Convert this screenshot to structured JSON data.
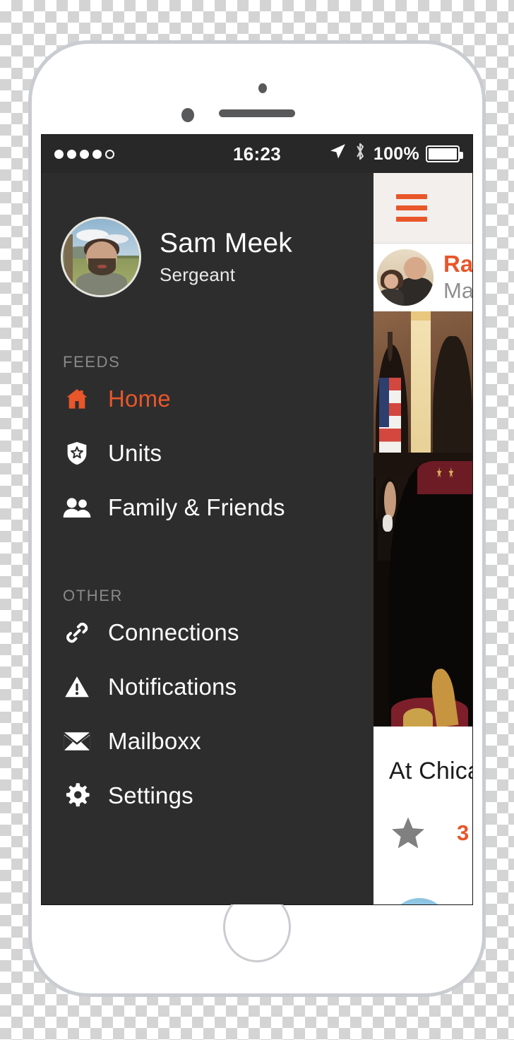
{
  "status_bar": {
    "signal_dots_filled": 4,
    "signal_dots_total": 5,
    "time": "16:23",
    "battery_percent": "100%",
    "location_icon": "location-arrow-icon",
    "bluetooth_icon": "bluetooth-icon",
    "battery_icon": "battery-full-icon"
  },
  "drawer": {
    "profile": {
      "name": "Sam Meek",
      "rank": "Sergeant",
      "avatar_alt": "sam-meek-avatar"
    },
    "sections": [
      {
        "title": "FEEDS",
        "items": [
          {
            "label": "Home",
            "icon": "home-icon",
            "active": true
          },
          {
            "label": "Units",
            "icon": "shield-star-icon",
            "active": false
          },
          {
            "label": "Family & Friends",
            "icon": "people-icon",
            "active": false
          }
        ]
      },
      {
        "title": "OTHER",
        "items": [
          {
            "label": "Connections",
            "icon": "link-icon",
            "active": false
          },
          {
            "label": "Notifications",
            "icon": "warning-triangle-icon",
            "active": false
          },
          {
            "label": "Mailboxx",
            "icon": "envelope-icon",
            "active": false
          },
          {
            "label": "Settings",
            "icon": "gear-icon",
            "active": false
          }
        ]
      }
    ]
  },
  "content_panel": {
    "menu_icon": "hamburger-menu-icon",
    "post": {
      "author": "Ray",
      "subtitle": "Mar",
      "avatar_alt": "ray-couple-avatar",
      "photo_alt": "dress-uniform-ceremony-photo",
      "caption": "At Chicag",
      "star_icon": "star-icon",
      "star_count": "3"
    },
    "next_post_avatar_alt": "next-post-avatar"
  },
  "colors": {
    "accent_orange": "#e8562a",
    "drawer_background": "#2d2d2d",
    "status_bar_background": "#282828",
    "section_title_gray": "#8a8a8a",
    "subtitle_gray": "#8e8e8e",
    "star_gray": "#808080"
  },
  "device": {
    "body_color": "#ffffff",
    "bezel_color": "#c9ccd0",
    "home_button": "home-button"
  }
}
